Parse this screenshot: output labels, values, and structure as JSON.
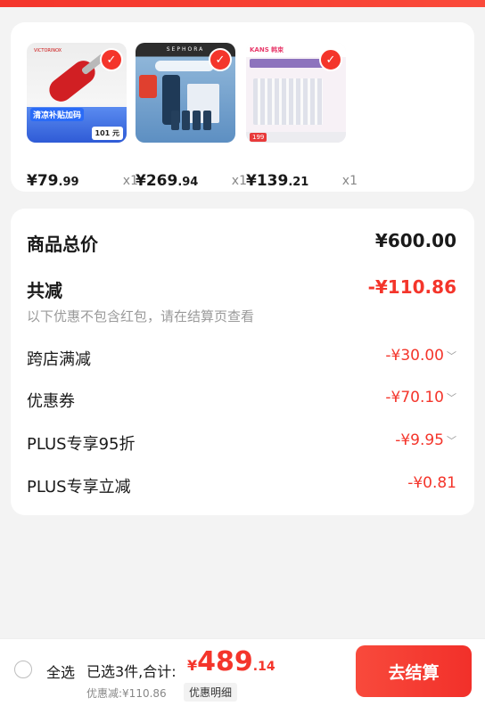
{
  "products": [
    {
      "price_main": "¥79",
      "price_cents": ".99",
      "qty": "x1",
      "badge_text": "清凉补贴加码",
      "chip_text": "101 元",
      "thumb_icon": "red-pocket-knife"
    },
    {
      "price_main": "¥269",
      "price_cents": ".94",
      "qty": "x1",
      "brand_text": "SEPHORA",
      "thumb_icon": "skincare-set"
    },
    {
      "price_main": "¥139",
      "price_cents": ".21",
      "qty": "x1",
      "brand_text": "KANS 韩束",
      "tag_text": "199",
      "thumb_icon": "facial-mask-set"
    }
  ],
  "summary": {
    "total_label": "商品总价",
    "total_value": "¥600.00",
    "reduce_label": "共减",
    "reduce_value": "-¥110.86",
    "note": "以下优惠不包含红包，请在结算页查看",
    "items": [
      {
        "label": "跨店满减",
        "value": "-¥30.00",
        "has_chevron": true
      },
      {
        "label": "优惠券",
        "value": "-¥70.10",
        "has_chevron": true
      },
      {
        "label": "PLUS专享95折",
        "value": "-¥9.95",
        "has_chevron": true
      },
      {
        "label": "PLUS专享立减",
        "value": "-¥0.81",
        "has_chevron": false
      }
    ]
  },
  "bottom": {
    "select_all": "全选",
    "selected": "已选3件,合计:",
    "currency": "¥",
    "sum_big": "489",
    "sum_small": ".14",
    "discount": "优惠减:¥110.86",
    "detail": "优惠明细",
    "checkout": "去结算"
  },
  "colors": {
    "accent": "#f4352b",
    "muted": "#9a9a9a"
  }
}
